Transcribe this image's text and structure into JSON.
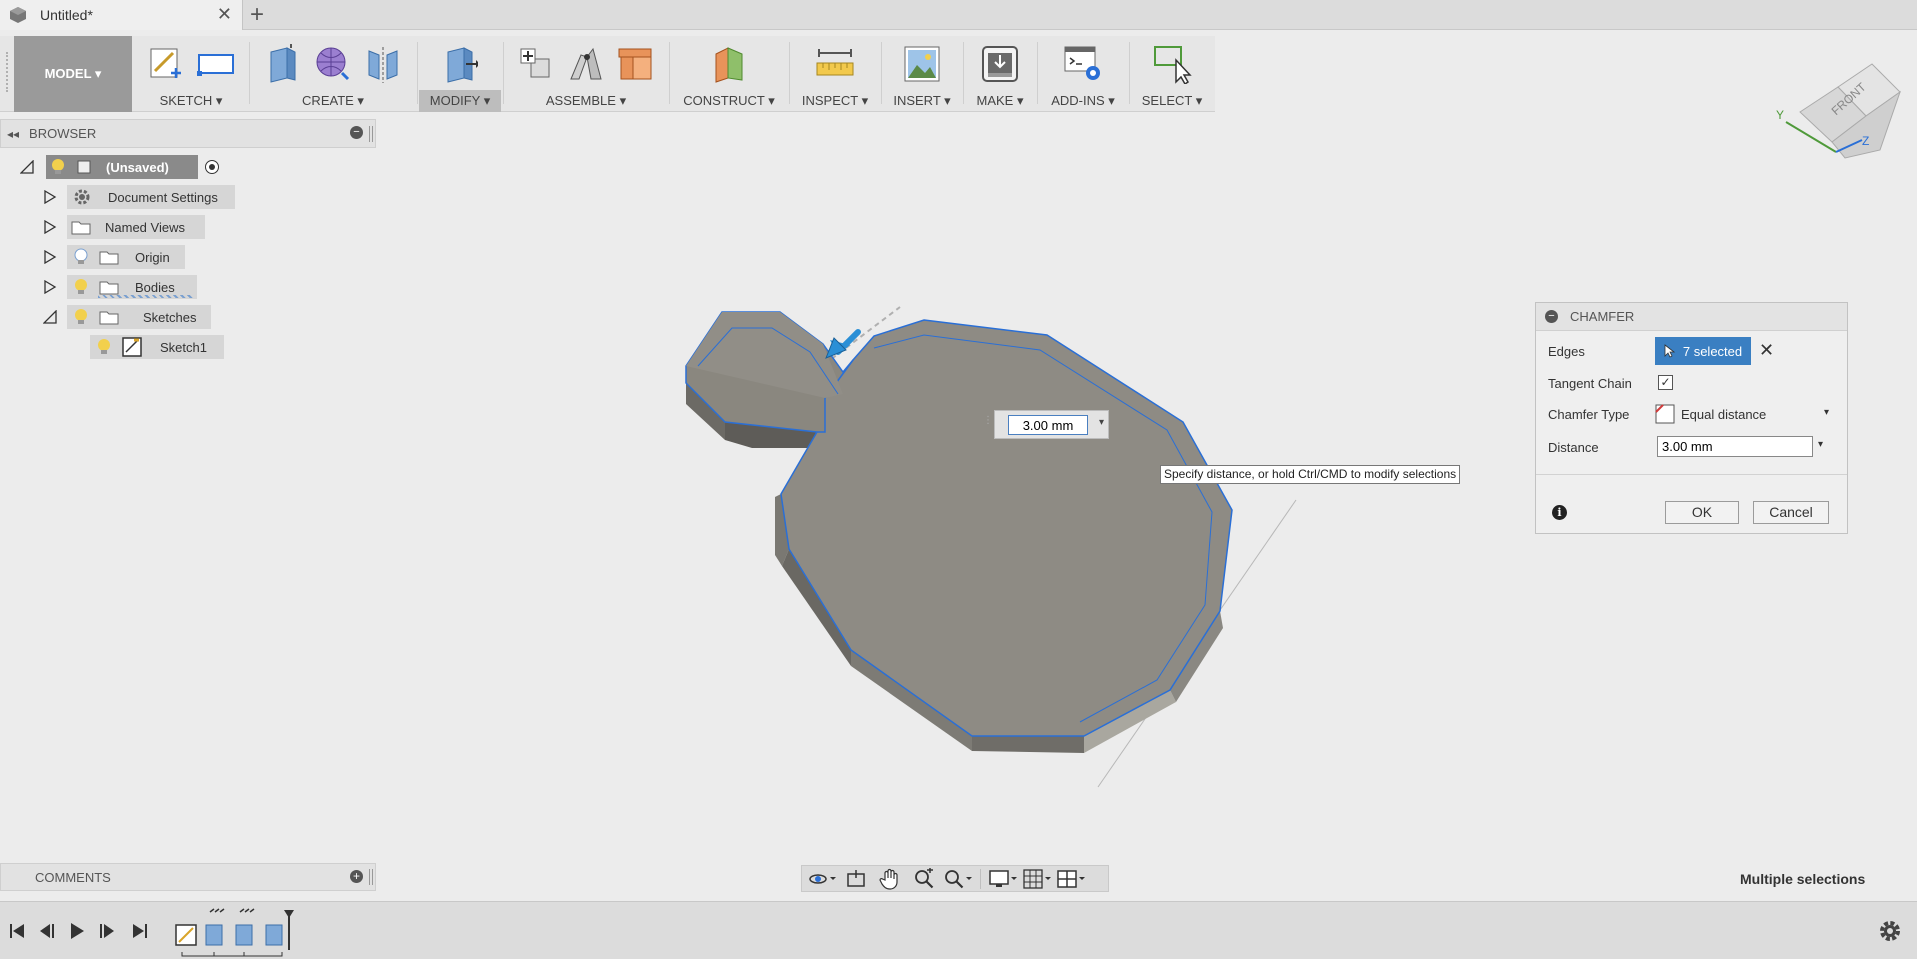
{
  "tab": {
    "title": "Untitled*",
    "close": "✕",
    "add": "+"
  },
  "toolbar": {
    "model_label": "MODEL ▾",
    "groups": {
      "sketch": "SKETCH ▾",
      "create": "CREATE ▾",
      "modify": "MODIFY ▾",
      "assemble": "ASSEMBLE ▾",
      "construct": "CONSTRUCT ▾",
      "inspect": "INSPECT ▾",
      "insert": "INSERT ▾",
      "make": "MAKE ▾",
      "addins": "ADD-INS ▾",
      "select": "SELECT ▾"
    }
  },
  "browser": {
    "title": "BROWSER",
    "items": [
      {
        "label": "(Unsaved)"
      },
      {
        "label": "Document Settings"
      },
      {
        "label": "Named Views"
      },
      {
        "label": "Origin"
      },
      {
        "label": "Bodies"
      },
      {
        "label": "Sketches"
      },
      {
        "label": "Sketch1"
      }
    ]
  },
  "viewcube": {
    "face": "FRONT",
    "axis_y": "Y",
    "axis_z": "Z"
  },
  "viewport": {
    "dimension_value": "3.00 mm",
    "tooltip": "Specify distance, or hold Ctrl/CMD to modify selections"
  },
  "chamfer": {
    "title": "CHAMFER",
    "edges_label": "Edges",
    "edges_value": "7 selected",
    "tangent_chain_label": "Tangent Chain",
    "tangent_chain_checked": "✓",
    "chamfer_type_label": "Chamfer Type",
    "chamfer_type_value": "Equal distance",
    "distance_label": "Distance",
    "distance_value": "3.00 mm",
    "ok": "OK",
    "cancel": "Cancel",
    "info": "i"
  },
  "comments": {
    "title": "COMMENTS"
  },
  "status": {
    "text": "Multiple selections"
  },
  "colors": {
    "accent": "#3a7fc2",
    "body": "#8e8b84",
    "edge": "#2a6fd6",
    "background": "#ececec"
  }
}
